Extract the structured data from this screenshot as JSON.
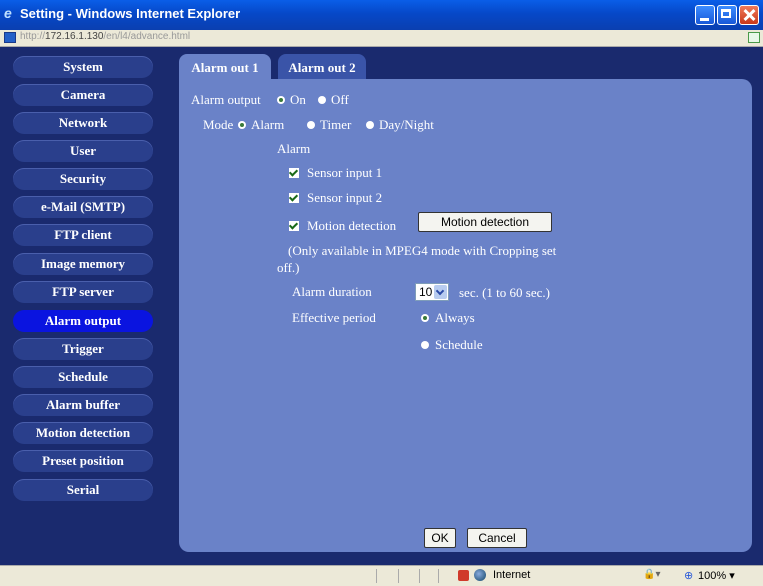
{
  "window": {
    "title": "Setting - Windows Internet Explorer",
    "icon": "ie-logo-icon"
  },
  "address": {
    "url_prefix": "http://",
    "url_host": "172.16.1.130",
    "url_path": "/en/l4/advance.html"
  },
  "sidebar": {
    "items": [
      {
        "label": "System"
      },
      {
        "label": "Camera"
      },
      {
        "label": "Network"
      },
      {
        "label": "User"
      },
      {
        "label": "Security"
      },
      {
        "label": "e-Mail (SMTP)"
      },
      {
        "label": "FTP client"
      },
      {
        "label": "Image memory"
      },
      {
        "label": "FTP server"
      },
      {
        "label": "Alarm output"
      },
      {
        "label": "Trigger"
      },
      {
        "label": "Schedule"
      },
      {
        "label": "Alarm buffer"
      },
      {
        "label": "Motion detection"
      },
      {
        "label": "Preset position"
      },
      {
        "label": "Serial"
      }
    ],
    "active": "Alarm output"
  },
  "tabs": [
    {
      "label": "Alarm out 1",
      "active": true
    },
    {
      "label": "Alarm out 2",
      "active": false
    }
  ],
  "form": {
    "alarm_output_label": "Alarm output",
    "alarm_output_on": "On",
    "alarm_output_off": "Off",
    "alarm_output_value": "On",
    "mode_label": "Mode",
    "mode_alarm": "Alarm",
    "mode_timer": "Timer",
    "mode_daynight": "Day/Night",
    "mode_value": "Alarm",
    "alarm_section": "Alarm",
    "sensor1": "Sensor input 1",
    "sensor2": "Sensor input 2",
    "motion": "Motion detection",
    "motion_button": "Motion detection",
    "note_line1": "(Only available in MPEG4 mode with Cropping set",
    "note_line2": "off.)",
    "duration_label": "Alarm duration",
    "duration_value": "10",
    "duration_unit": "sec. (1 to 60 sec.)",
    "period_label": "Effective period",
    "period_always": "Always",
    "period_schedule": "Schedule",
    "period_value": "Always",
    "ok": "OK",
    "cancel": "Cancel"
  },
  "status": {
    "zone": "Internet",
    "zoom": "100%",
    "zoom_icon": "zoom-icon",
    "security_icon": "security-icon"
  },
  "colors": {
    "background": "#1a2a6e",
    "panel": "#6a82c8",
    "nav_active": "#0a14e0"
  }
}
